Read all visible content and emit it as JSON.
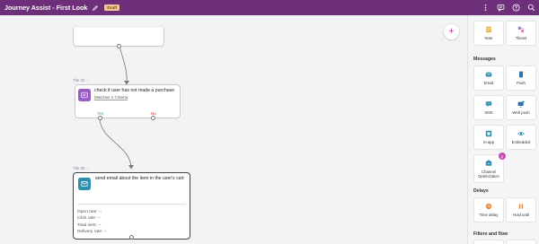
{
  "header": {
    "title": "Journey Assist - First Look",
    "status_badge": "Draft",
    "icons": [
      "more-vertical-icon",
      "comment-icon",
      "help-icon",
      "search-icon"
    ]
  },
  "canvas": {
    "check_tile": {
      "tile_id": "Tile ID: -",
      "text": "check if user has not made a purchase",
      "criteria": "Matches 1 Criteria",
      "yes_label": "Yes",
      "no_label": "No"
    },
    "email_tile": {
      "tile_id": "Tile ID: -",
      "text": "send email about the item in the user's cart",
      "open_rate": "Open rate: --",
      "click_rate": "Click rate: --",
      "total_sent": "Total sent: --",
      "delivery_rate": "Delivery rate: --"
    },
    "add_button": "+"
  },
  "sidebar": {
    "top_items": [
      {
        "label": "Note",
        "icon": "note-icon"
      },
      {
        "label": "Tileset",
        "icon": "tileset-icon"
      }
    ],
    "messages_title": "Messages",
    "messages": [
      {
        "label": "Email",
        "icon": "email-icon"
      },
      {
        "label": "Push",
        "icon": "push-icon"
      },
      {
        "label": "SMS",
        "icon": "sms-icon"
      },
      {
        "label": "Web push",
        "icon": "web-push-icon"
      },
      {
        "label": "In-app",
        "icon": "in-app-icon"
      },
      {
        "label": "Embedded",
        "icon": "embedded-icon"
      },
      {
        "label": "Channel Optimization",
        "icon": "channel-optimization-icon",
        "beta": "β"
      }
    ],
    "delays_title": "Delays",
    "delays": [
      {
        "label": "Time delay",
        "icon": "time-delay-icon"
      },
      {
        "label": "Hold until",
        "icon": "hold-until-icon"
      }
    ],
    "filters_title": "Filters and flow"
  },
  "colors": {
    "header_bg": "#6e2f7a",
    "draft_badge": "#f4c89a",
    "check_icon_bg": "#9b5bc6",
    "email_icon_bg": "#2d8fb0",
    "accent_pink": "#d03aa6",
    "yes_color": "#3b9b57",
    "no_color": "#c0392b"
  }
}
